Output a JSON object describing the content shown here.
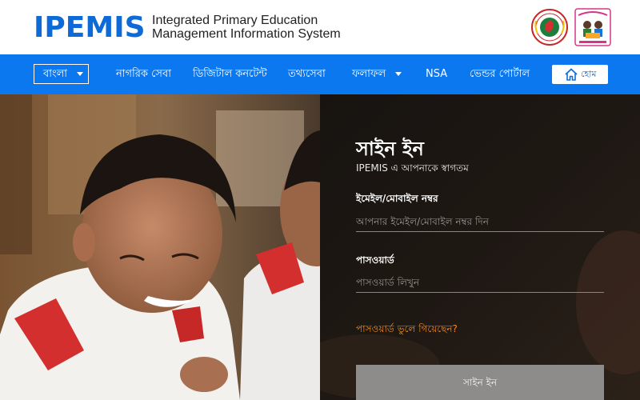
{
  "header": {
    "logo": "IPEMIS",
    "subtitle_line1": "Integrated Primary Education",
    "subtitle_line2": "Management Information System"
  },
  "nav": {
    "language": "বাংলা",
    "items": [
      "নাগরিক সেবা",
      "ডিজিটাল কনটেন্ট",
      "তথ্যসেবা",
      "ফলাফল",
      "NSA",
      "ভেন্ডর পোর্টাল"
    ],
    "home_label": "হোম"
  },
  "signin": {
    "title": "সাইন ইন",
    "welcome": "IPEMIS এ আপনাকে স্বাগতম",
    "email_label": "ইমেইল/মোবাইল নম্বর",
    "email_placeholder": "আপনার ইমেইল/মোবাইল নম্বর দিন",
    "password_label": "পাসওয়ার্ড",
    "password_placeholder": "পাসওয়ার্ড লিখুন",
    "forgot": "পাসওয়ার্ড ভুলে গিয়েছেন?",
    "button": "সাইন ইন"
  },
  "colors": {
    "brand_blue": "#0b78f0",
    "forgot_orange": "#f08a24"
  }
}
